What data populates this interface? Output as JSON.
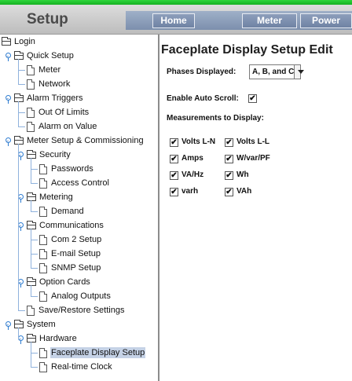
{
  "header": {
    "app_title": "Setup",
    "nav": {
      "home": "Home",
      "meter": "Meter",
      "power": "Power"
    }
  },
  "tree": [
    {
      "label": "Login",
      "type": "folder",
      "toggle": false
    },
    {
      "label": "Quick Setup",
      "type": "folder",
      "toggle": true
    },
    {
      "label": "Meter",
      "type": "doc",
      "toggle": false
    },
    {
      "label": "Network",
      "type": "doc",
      "toggle": false
    },
    {
      "label": "Alarm Triggers",
      "type": "folder",
      "toggle": true
    },
    {
      "label": "Out Of Limits",
      "type": "doc",
      "toggle": false
    },
    {
      "label": "Alarm on Value",
      "type": "doc",
      "toggle": false
    },
    {
      "label": "Meter Setup & Commissioning",
      "type": "folder",
      "toggle": true
    },
    {
      "label": "Security",
      "type": "folder",
      "toggle": true
    },
    {
      "label": "Passwords",
      "type": "doc",
      "toggle": false
    },
    {
      "label": "Access Control",
      "type": "doc",
      "toggle": false
    },
    {
      "label": "Metering",
      "type": "folder",
      "toggle": true
    },
    {
      "label": "Demand",
      "type": "doc",
      "toggle": false
    },
    {
      "label": "Communications",
      "type": "folder",
      "toggle": true
    },
    {
      "label": "Com 2 Setup",
      "type": "doc",
      "toggle": false
    },
    {
      "label": "E-mail Setup",
      "type": "doc",
      "toggle": false
    },
    {
      "label": "SNMP Setup",
      "type": "doc",
      "toggle": false
    },
    {
      "label": "Option Cards",
      "type": "folder",
      "toggle": true
    },
    {
      "label": "Analog Outputs",
      "type": "doc",
      "toggle": false
    },
    {
      "label": "Save/Restore Settings",
      "type": "doc",
      "toggle": false
    },
    {
      "label": "System",
      "type": "folder",
      "toggle": true
    },
    {
      "label": "Hardware",
      "type": "folder",
      "toggle": true
    },
    {
      "label": "Faceplate Display Setup",
      "type": "doc",
      "toggle": false,
      "selected": true
    },
    {
      "label": "Real-time Clock",
      "type": "doc",
      "toggle": false
    }
  ],
  "main": {
    "title": "Faceplate Display Setup Edit",
    "phases_label": "Phases Displayed:",
    "phases_value": "A, B, and C",
    "autoscroll_label": "Enable Auto Scroll:",
    "autoscroll_checked": true,
    "measurements_label": "Measurements to Display:",
    "measurements": [
      {
        "label": "Volts L-N",
        "checked": true
      },
      {
        "label": "Volts L-L",
        "checked": true
      },
      {
        "label": "Amps",
        "checked": true
      },
      {
        "label": "W/var/PF",
        "checked": true
      },
      {
        "label": "VA/Hz",
        "checked": true
      },
      {
        "label": "Wh",
        "checked": true
      },
      {
        "label": "varh",
        "checked": true
      },
      {
        "label": "VAh",
        "checked": true
      }
    ]
  },
  "colors": {
    "top_stripe": "#2fd63c",
    "nav_button": "#7c8fad",
    "selected_row": "#c5d2e6"
  }
}
